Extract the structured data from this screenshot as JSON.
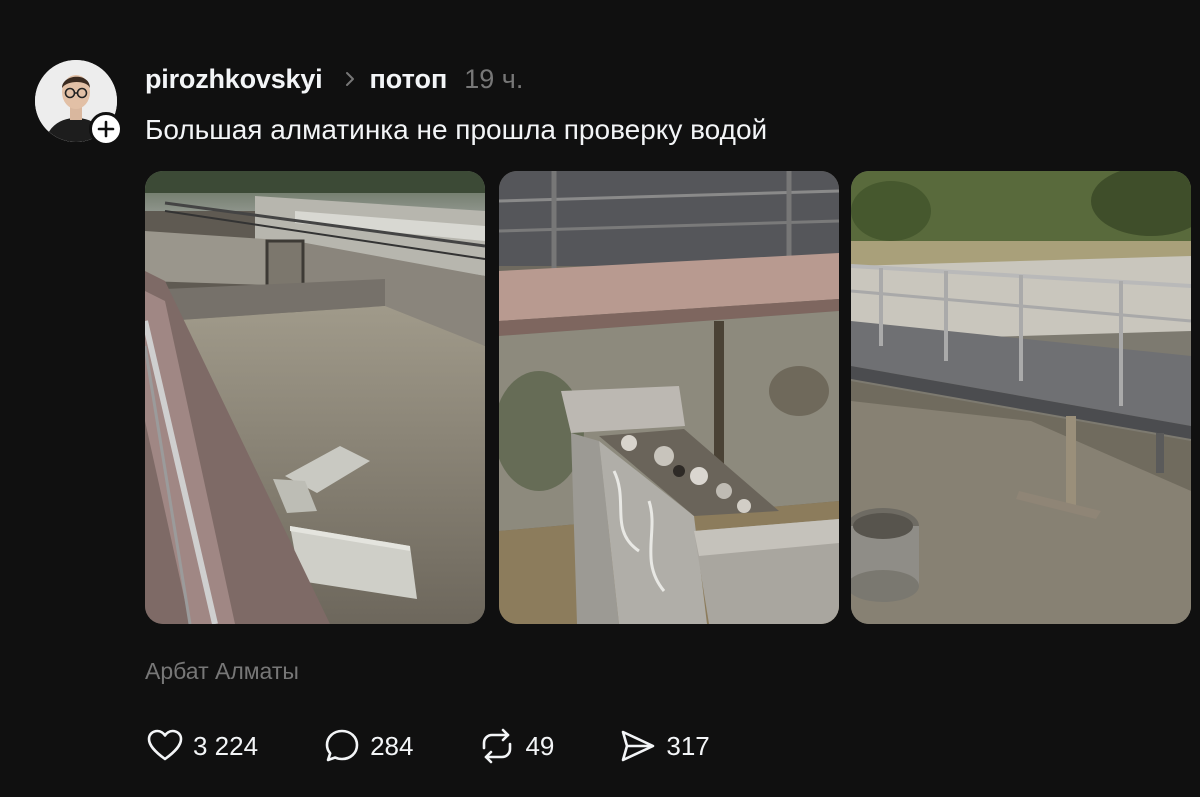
{
  "post": {
    "username": "pirozhkovskyi",
    "topic": "потоп",
    "time": "19 ч.",
    "text": "Большая алматинка не прошла проверку водой",
    "location": "Арбат Алматы"
  },
  "gallery": [
    {
      "subject": "flooded concrete river channel with loose slabs"
    },
    {
      "subject": "damaged stone wall block with rubble"
    },
    {
      "subject": "footbridge over muddy channel"
    }
  ],
  "actions": {
    "likes": "3 224",
    "comments": "284",
    "reposts": "49",
    "shares": "317"
  },
  "icons": {
    "like": "heart-icon",
    "comment": "comment-bubble-icon",
    "repost": "repost-icon",
    "share": "send-icon",
    "follow": "plus-icon",
    "separator": "chevron-right-icon"
  },
  "colors": {
    "background": "#101010",
    "primary_text": "#f3f5f7",
    "secondary_text": "#777777"
  }
}
